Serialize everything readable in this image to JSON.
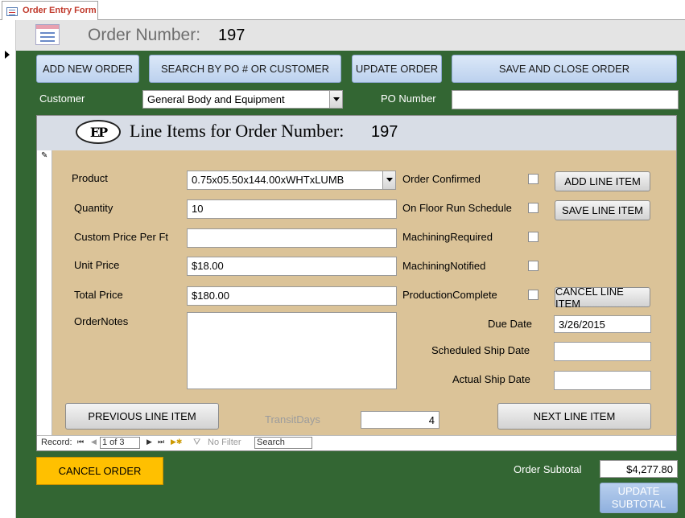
{
  "tab": {
    "label": "Order Entry Form",
    "icon": "form-icon"
  },
  "header": {
    "order_number_label": "Order Number:",
    "order_number": "197"
  },
  "toolbar": {
    "add_new_order": "ADD NEW ORDER",
    "search": "SEARCH BY PO # OR CUSTOMER",
    "update_order": "UPDATE ORDER",
    "save_close": "SAVE AND CLOSE ORDER"
  },
  "customer": {
    "label": "Customer",
    "value": "General Body and Equipment"
  },
  "po": {
    "label": "PO Number",
    "value": ""
  },
  "line_items": {
    "title": "Line Items for Order Number:",
    "order_number": "197",
    "logo_text": "EP",
    "product": {
      "label": "Product",
      "value": "0.75x05.50x144.00xWHTxLUMB"
    },
    "quantity": {
      "label": "Quantity",
      "value": "10"
    },
    "custom_price": {
      "label": "Custom Price Per Ft",
      "value": ""
    },
    "unit_price": {
      "label": "Unit Price",
      "value": "$18.00"
    },
    "total_price": {
      "label": "Total Price",
      "value": "$180.00"
    },
    "order_notes": {
      "label": "OrderNotes",
      "value": ""
    },
    "checks": {
      "order_confirmed": {
        "label": "Order Confirmed",
        "checked": false
      },
      "on_floor": {
        "label": "On Floor Run Schedule",
        "checked": false
      },
      "machining_required": {
        "label": "MachiningRequired",
        "checked": false
      },
      "machining_notified": {
        "label": "MachiningNotified",
        "checked": false
      },
      "production_complete": {
        "label": "ProductionComplete",
        "checked": false
      }
    },
    "buttons": {
      "add": "ADD LINE ITEM",
      "save": "SAVE LINE ITEM",
      "cancel": "CANCEL LINE ITEM",
      "previous": "PREVIOUS LINE ITEM",
      "next": "NEXT LINE ITEM"
    },
    "due_date": {
      "label": "Due Date",
      "value": "3/26/2015"
    },
    "scheduled_ship": {
      "label": "Scheduled Ship Date",
      "value": ""
    },
    "actual_ship": {
      "label": "Actual Ship Date",
      "value": ""
    },
    "transit_days": {
      "label": "TransitDays",
      "value": "4"
    },
    "nav": {
      "record_label": "Record:",
      "position": "1 of 3",
      "filter": "No Filter",
      "search": "Search"
    }
  },
  "footer": {
    "cancel_order": "CANCEL ORDER",
    "subtotal_label": "Order Subtotal",
    "subtotal_value": "$4,277.80",
    "update_subtotal": "UPDATE SUBTOTAL"
  },
  "colors": {
    "body": "#336633",
    "subform": "#dbc398",
    "cancel": "#ffc000"
  }
}
